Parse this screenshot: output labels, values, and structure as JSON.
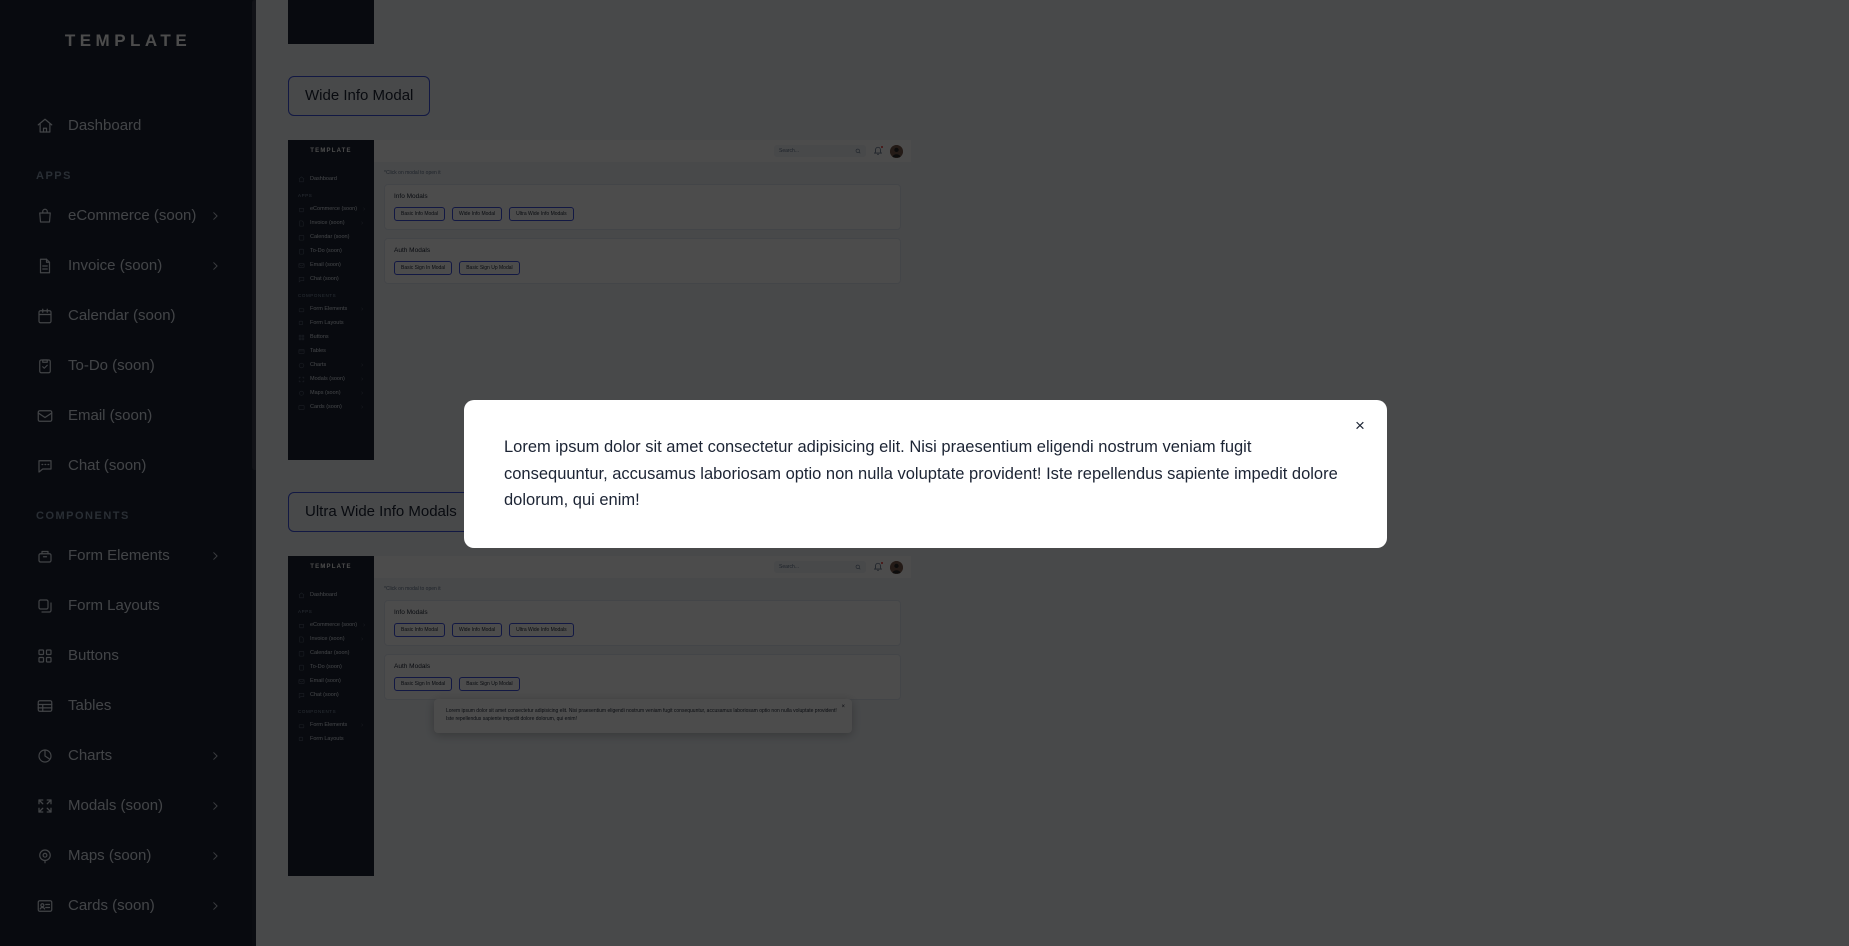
{
  "sidebar": {
    "logo": "TEMPLATE",
    "menu_item": {
      "label": "Dashboard",
      "icon": "home-icon"
    },
    "groups": [
      {
        "title": "APPS",
        "items": [
          {
            "label": "eCommerce (soon)",
            "icon": "bag-icon",
            "chevron": true
          },
          {
            "label": "Invoice (soon)",
            "icon": "document-icon",
            "chevron": true
          },
          {
            "label": "Calendar (soon)",
            "icon": "calendar-icon",
            "chevron": false
          },
          {
            "label": "To-Do (soon)",
            "icon": "clipboard-check-icon",
            "chevron": false
          },
          {
            "label": "Email (soon)",
            "icon": "inbox-icon",
            "chevron": false
          },
          {
            "label": "Chat (soon)",
            "icon": "chat-bubble-icon",
            "chevron": false
          }
        ]
      },
      {
        "title": "COMPONENTS",
        "items": [
          {
            "label": "Form Elements",
            "icon": "toolbox-icon",
            "chevron": true
          },
          {
            "label": "Form Layouts",
            "icon": "copy-icon",
            "chevron": false
          },
          {
            "label": "Buttons",
            "icon": "grid-icon",
            "chevron": false
          },
          {
            "label": "Tables",
            "icon": "table-icon",
            "chevron": false
          },
          {
            "label": "Charts",
            "icon": "pie-chart-icon",
            "chevron": true
          },
          {
            "label": "Modals (soon)",
            "icon": "expand-icon",
            "chevron": true
          },
          {
            "label": "Maps (soon)",
            "icon": "map-pin-icon",
            "chevron": true
          },
          {
            "label": "Cards (soon)",
            "icon": "id-card-icon",
            "chevron": true
          }
        ]
      }
    ]
  },
  "main": {
    "buttons": {
      "wide_info_modal": "Wide Info Modal",
      "ultra_wide_info_modals": "Ultra Wide Info Modals"
    },
    "preview": {
      "logo": "TEMPLATE",
      "note": "*Click on modal to open it",
      "search_placeholder": "Search...",
      "info_panel": {
        "title": "Info Modals",
        "buttons": [
          "Basic Info Modal",
          "Wide Info Modal",
          "Ultra Wide Info Modals"
        ]
      },
      "auth_panel": {
        "title": "Auth Modals",
        "buttons": [
          "Basic Sign In Modal",
          "Basic Sign Up Modal"
        ]
      },
      "inner_modal_text": "Lorem ipsum dolor sit amet consectetur adipisicing elit. Nisi praesentium eligendi nostrum veniam fugit consequuntur, accusamus laboriosam optio non nulla voluptate provident! Iste repellendus sapiente impedit dolore dolorum, qui enim!",
      "close_label": "×"
    }
  },
  "modal": {
    "text": "Lorem ipsum dolor sit amet consectetur adipisicing elit. Nisi praesentium eligendi nostrum veniam fugit consequuntur, accusamus laboriosam optio non nulla voluptate provident! Iste repellendus sapiente impedit dolore dolorum, qui enim!",
    "close_label": "×"
  },
  "colors": {
    "sidebar_bg": "#1c2434",
    "page_bg": "#f1f5f9",
    "accent": "#3c50e0",
    "badge": "#f23030",
    "modal_bg": "#ffffff",
    "overlay": "rgba(0,0,0,0.70)"
  }
}
